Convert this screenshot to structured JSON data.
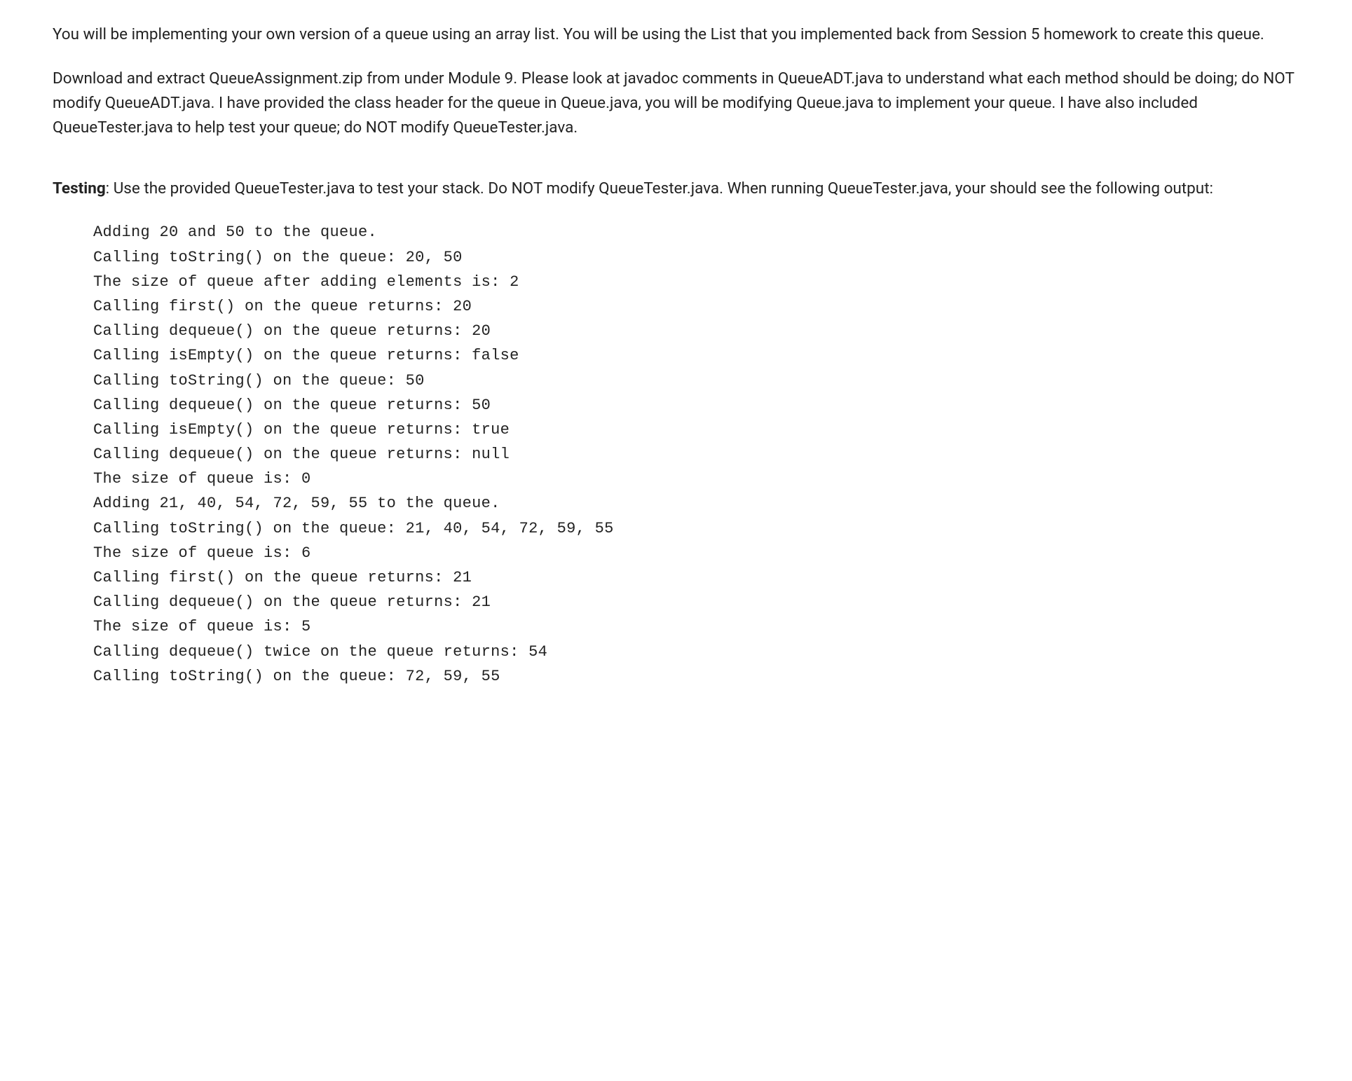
{
  "paragraph1": "You will be implementing your own version of a queue using an array list.  You will be using the List that you implemented back from Session 5 homework to create this queue.",
  "paragraph2": "Download and extract QueueAssignment.zip from under Module 9. Please look at javadoc comments in QueueADT.java to understand what each method should be doing; do NOT modify QueueADT.java. I have provided the class header for the queue in Queue.java, you will be modifying Queue.java to implement your queue. I have also included QueueTester.java to help test your queue; do NOT modify QueueTester.java.",
  "testing_label": "Testing",
  "testing_text": ": Use the provided QueueTester.java to test your stack.  Do NOT modify QueueTester.java.  When running QueueTester.java, your should see the following output:",
  "output_lines": [
    "Adding 20 and 50 to the queue.",
    "Calling toString() on the queue: 20, 50",
    "The size of queue after adding elements is: 2",
    "Calling first() on the queue returns: 20",
    "Calling dequeue() on the queue returns: 20",
    "Calling isEmpty() on the queue returns: false",
    "Calling toString() on the queue: 50",
    "Calling dequeue() on the queue returns: 50",
    "Calling isEmpty() on the queue returns: true",
    "Calling dequeue() on the queue returns: null",
    "The size of queue is: 0",
    "Adding 21, 40, 54, 72, 59, 55 to the queue.",
    "Calling toString() on the queue: 21, 40, 54, 72, 59, 55",
    "The size of queue is: 6",
    "Calling first() on the queue returns: 21",
    "Calling dequeue() on the queue returns: 21",
    "The size of queue is: 5",
    "Calling dequeue() twice on the queue returns: 54",
    "Calling toString() on the queue: 72, 59, 55"
  ]
}
